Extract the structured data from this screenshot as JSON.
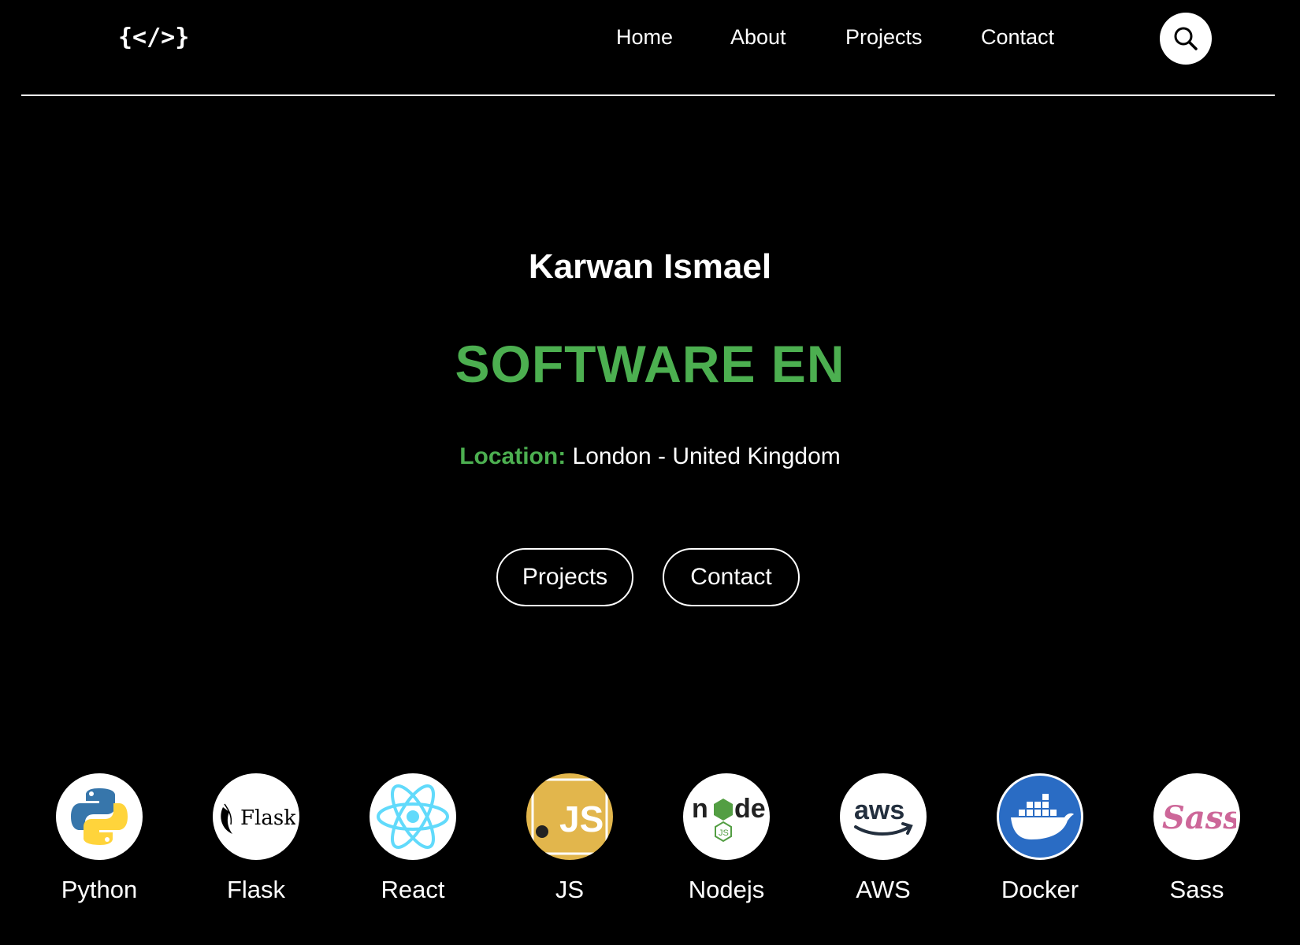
{
  "header": {
    "logo": "{</>}",
    "nav": [
      "Home",
      "About",
      "Projects",
      "Contact"
    ],
    "search_icon": "search-icon"
  },
  "hero": {
    "name": "Karwan Ismael",
    "role": "SOFTWARE EN",
    "location_label": "Location:",
    "location_value": "London - United Kingdom",
    "buttons": [
      "Projects",
      "Contact"
    ]
  },
  "skills": [
    {
      "label": "Python",
      "icon": "python-icon"
    },
    {
      "label": "Flask",
      "icon": "flask-icon"
    },
    {
      "label": "React",
      "icon": "react-icon"
    },
    {
      "label": "JS",
      "icon": "javascript-icon"
    },
    {
      "label": "Nodejs",
      "icon": "nodejs-icon"
    },
    {
      "label": "AWS",
      "icon": "aws-icon"
    },
    {
      "label": "Docker",
      "icon": "docker-icon"
    },
    {
      "label": "Sass",
      "icon": "sass-icon"
    }
  ],
  "colors": {
    "background": "#000000",
    "accent": "#4caf50",
    "text": "#ffffff"
  }
}
